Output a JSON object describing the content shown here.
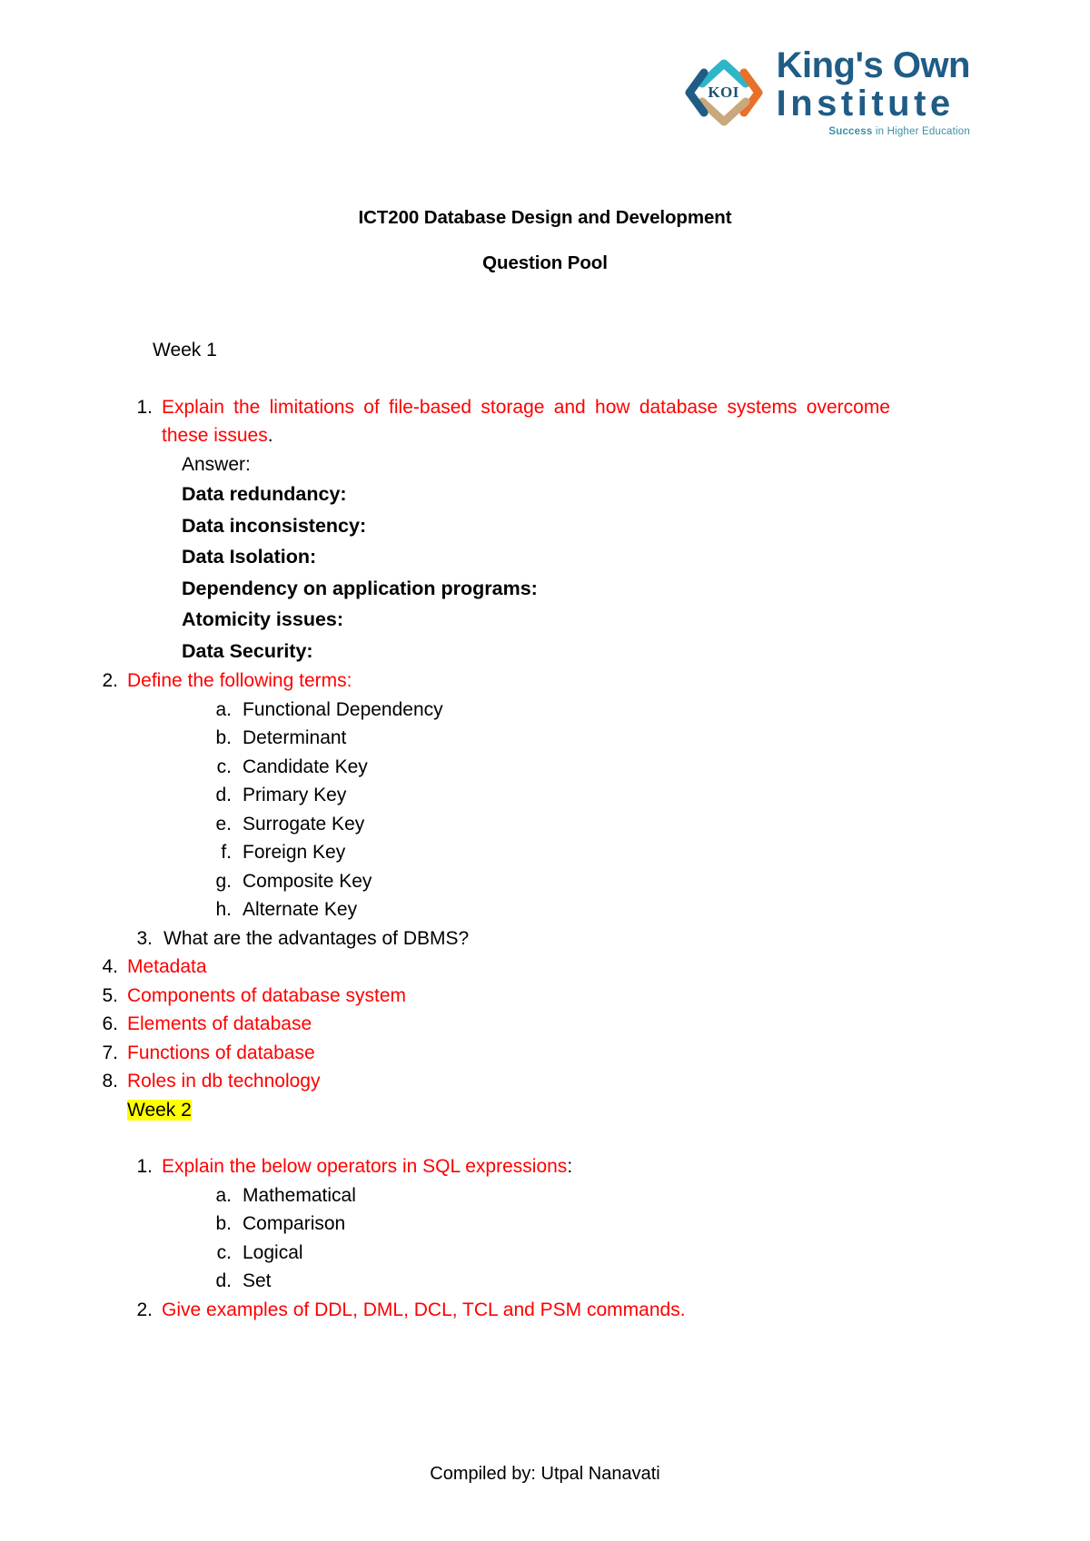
{
  "logo": {
    "mark_text": "KOI",
    "line1": "King's Own",
    "line2": "Institute",
    "tagline_bold": "Success",
    "tagline_rest": " in Higher Education",
    "colors": {
      "top_chevron": "#2eb6c8",
      "left_chevron": "#1f5c86",
      "right_chevron": "#e8702a",
      "bottom_chevron": "#c9a87c",
      "wordmark": "#1f5c86",
      "tagline": "#3c8fa8"
    }
  },
  "document": {
    "title": "ICT200 Database Design and Development",
    "subtitle": "Question Pool",
    "footer": "Compiled by: Utpal Nanavati"
  },
  "colors": {
    "question_red": "#ff0000",
    "text_black": "#000000",
    "highlight_yellow": "#ffff00"
  },
  "week1": {
    "heading": "Week 1",
    "q1": {
      "marker": "1.",
      "text": "Explain the limitations of file-based storage and how database systems overcome these issues",
      "trailing_period": ".",
      "answer_label": "Answer:",
      "answer_items": [
        "Data redundancy:",
        "Data inconsistency:",
        "Data Isolation:",
        "Dependency on application programs:",
        "Atomicity issues:",
        "Data Security:"
      ]
    },
    "q2": {
      "marker": "2.",
      "text": "Define the following terms:",
      "sub_items": [
        {
          "marker": "a.",
          "label": "Functional Dependency"
        },
        {
          "marker": "b.",
          "label": "Determinant"
        },
        {
          "marker": "c.",
          "label": "Candidate Key"
        },
        {
          "marker": "d.",
          "label": "Primary Key"
        },
        {
          "marker": "e.",
          "label": "Surrogate Key"
        },
        {
          "marker": "f.",
          "label": "Foreign Key"
        },
        {
          "marker": "g.",
          "label": "Composite Key"
        },
        {
          "marker": "h.",
          "label": "Alternate Key"
        }
      ]
    },
    "q3": {
      "marker": "3.",
      "text": "What are the advantages of DBMS?"
    },
    "q4": {
      "marker": "4.",
      "text": "Metadata"
    },
    "q5": {
      "marker": "5.",
      "text": "Components of database system"
    },
    "q6": {
      "marker": "6.",
      "text": "Elements of database"
    },
    "q7": {
      "marker": "7.",
      "text": "Functions of database"
    },
    "q8": {
      "marker": "8.",
      "text": "Roles in db technology"
    }
  },
  "week2": {
    "heading": "Week 2",
    "q1": {
      "marker": "1.",
      "text": "Explain the below operators in SQL expressions",
      "trailing_colon": ":",
      "sub_items": [
        {
          "marker": "a.",
          "label": "Mathematical"
        },
        {
          "marker": "b.",
          "label": "Comparison"
        },
        {
          "marker": "c.",
          "label": "Logical"
        },
        {
          "marker": "d.",
          "label": "Set"
        }
      ]
    },
    "q2": {
      "marker": "2.",
      "text": "Give examples of DDL, DML, DCL, TCL and PSM commands."
    }
  }
}
